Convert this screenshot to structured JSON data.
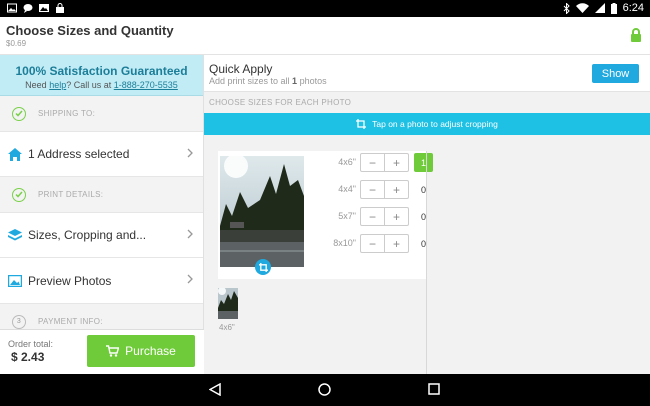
{
  "status_bar": {
    "time": "6:24",
    "left_icons": [
      "image-icon",
      "message-icon",
      "photo-icon",
      "lock-notification-icon"
    ],
    "right_icons": [
      "bluetooth-icon",
      "wifi-icon",
      "signal-icon",
      "battery-icon"
    ]
  },
  "app_bar": {
    "title": "Choose Sizes and Quantity",
    "subtitle": "$0.69",
    "icon": "lock-icon"
  },
  "sidebar": {
    "guarantee": {
      "title": "100% Satisfaction Guaranteed",
      "pre": "Need ",
      "help_link": "help",
      "mid": "? Call us at ",
      "phone_link": "1-888-270-5535"
    },
    "shipping_label": "SHIPPING TO:",
    "address_item": "1 Address selected",
    "print_details_label": "PRINT DETAILS:",
    "sizes_item": "Sizes, Cropping and...",
    "preview_item": "Preview Photos",
    "payment_step": "3",
    "payment_label": "PAYMENT INFO:",
    "order_total_label": "Order total:",
    "order_total_value": "$ 2.43",
    "purchase_label": "Purchase"
  },
  "main": {
    "quick_apply_title": "Quick Apply",
    "quick_apply_sub_pre": "Add print sizes to all ",
    "quick_apply_count": "1",
    "quick_apply_sub_post": " photos",
    "show_label": "Show",
    "choose_sizes_label": "CHOOSE SIZES FOR EACH PHOTO",
    "crop_banner": "Tap on a photo to adjust cropping",
    "sizes": [
      {
        "label": "4x6\"",
        "qty": "1",
        "active": true
      },
      {
        "label": "4x4\"",
        "qty": "0",
        "active": false
      },
      {
        "label": "5x7\"",
        "qty": "0",
        "active": false
      },
      {
        "label": "8x10\"",
        "qty": "0",
        "active": false
      }
    ],
    "minus": "−",
    "plus": "+",
    "strip_label": "4x6\""
  },
  "nav_bar": {
    "buttons": [
      "back-icon",
      "home-icon",
      "recents-icon"
    ]
  },
  "colors": {
    "accent_blue": "#1fa9df",
    "banner_cyan": "#1ec0e4",
    "green": "#6fcb3a",
    "guarantee_bg": "#c1ecf6"
  }
}
